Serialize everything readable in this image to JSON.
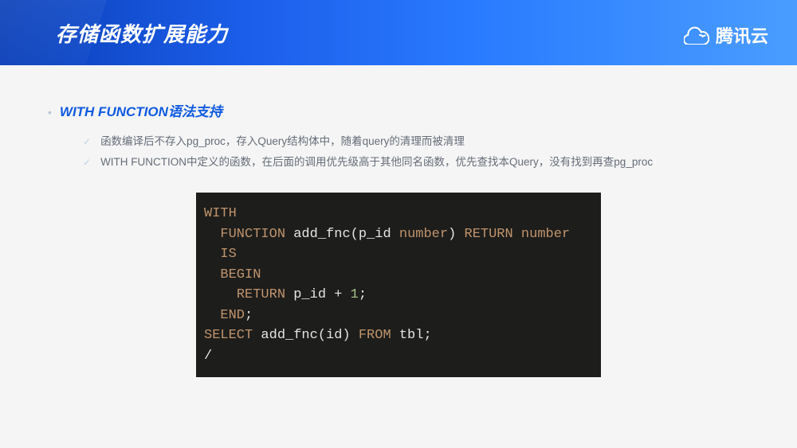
{
  "header": {
    "title": "存储函数扩展能力",
    "brand": "腾讯云"
  },
  "section": {
    "heading": "WITH FUNCTION语法支持",
    "bullets": [
      "函数编译后不存入pg_proc，存入Query结构体中，随着query的清理而被清理",
      "WITH FUNCTION中定义的函数，在后面的调用优先级高于其他同名函数，优先查找本Query，没有找到再查pg_proc"
    ]
  },
  "code": {
    "kw_with": "WITH",
    "kw_function": "FUNCTION",
    "fn_name": "add_fnc",
    "param_open": "(p_id ",
    "type_number1": "number",
    "param_close": ") ",
    "kw_return_decl": "RETURN",
    "space1": " ",
    "type_number2": "number",
    "kw_is": "IS",
    "kw_begin": "BEGIN",
    "indent_return": "    ",
    "kw_return_body": "RETURN",
    "body_expr_left": " p_id ",
    "op_plus": "+",
    "space2": " ",
    "lit_one": "1",
    "semi1": ";",
    "kw_end": "END",
    "semi2": ";",
    "kw_select": "SELECT",
    "sel_mid": " add_fnc(id) ",
    "kw_from": "FROM",
    "sel_tail": " tbl;",
    "slash": "/",
    "indent2": "  "
  }
}
